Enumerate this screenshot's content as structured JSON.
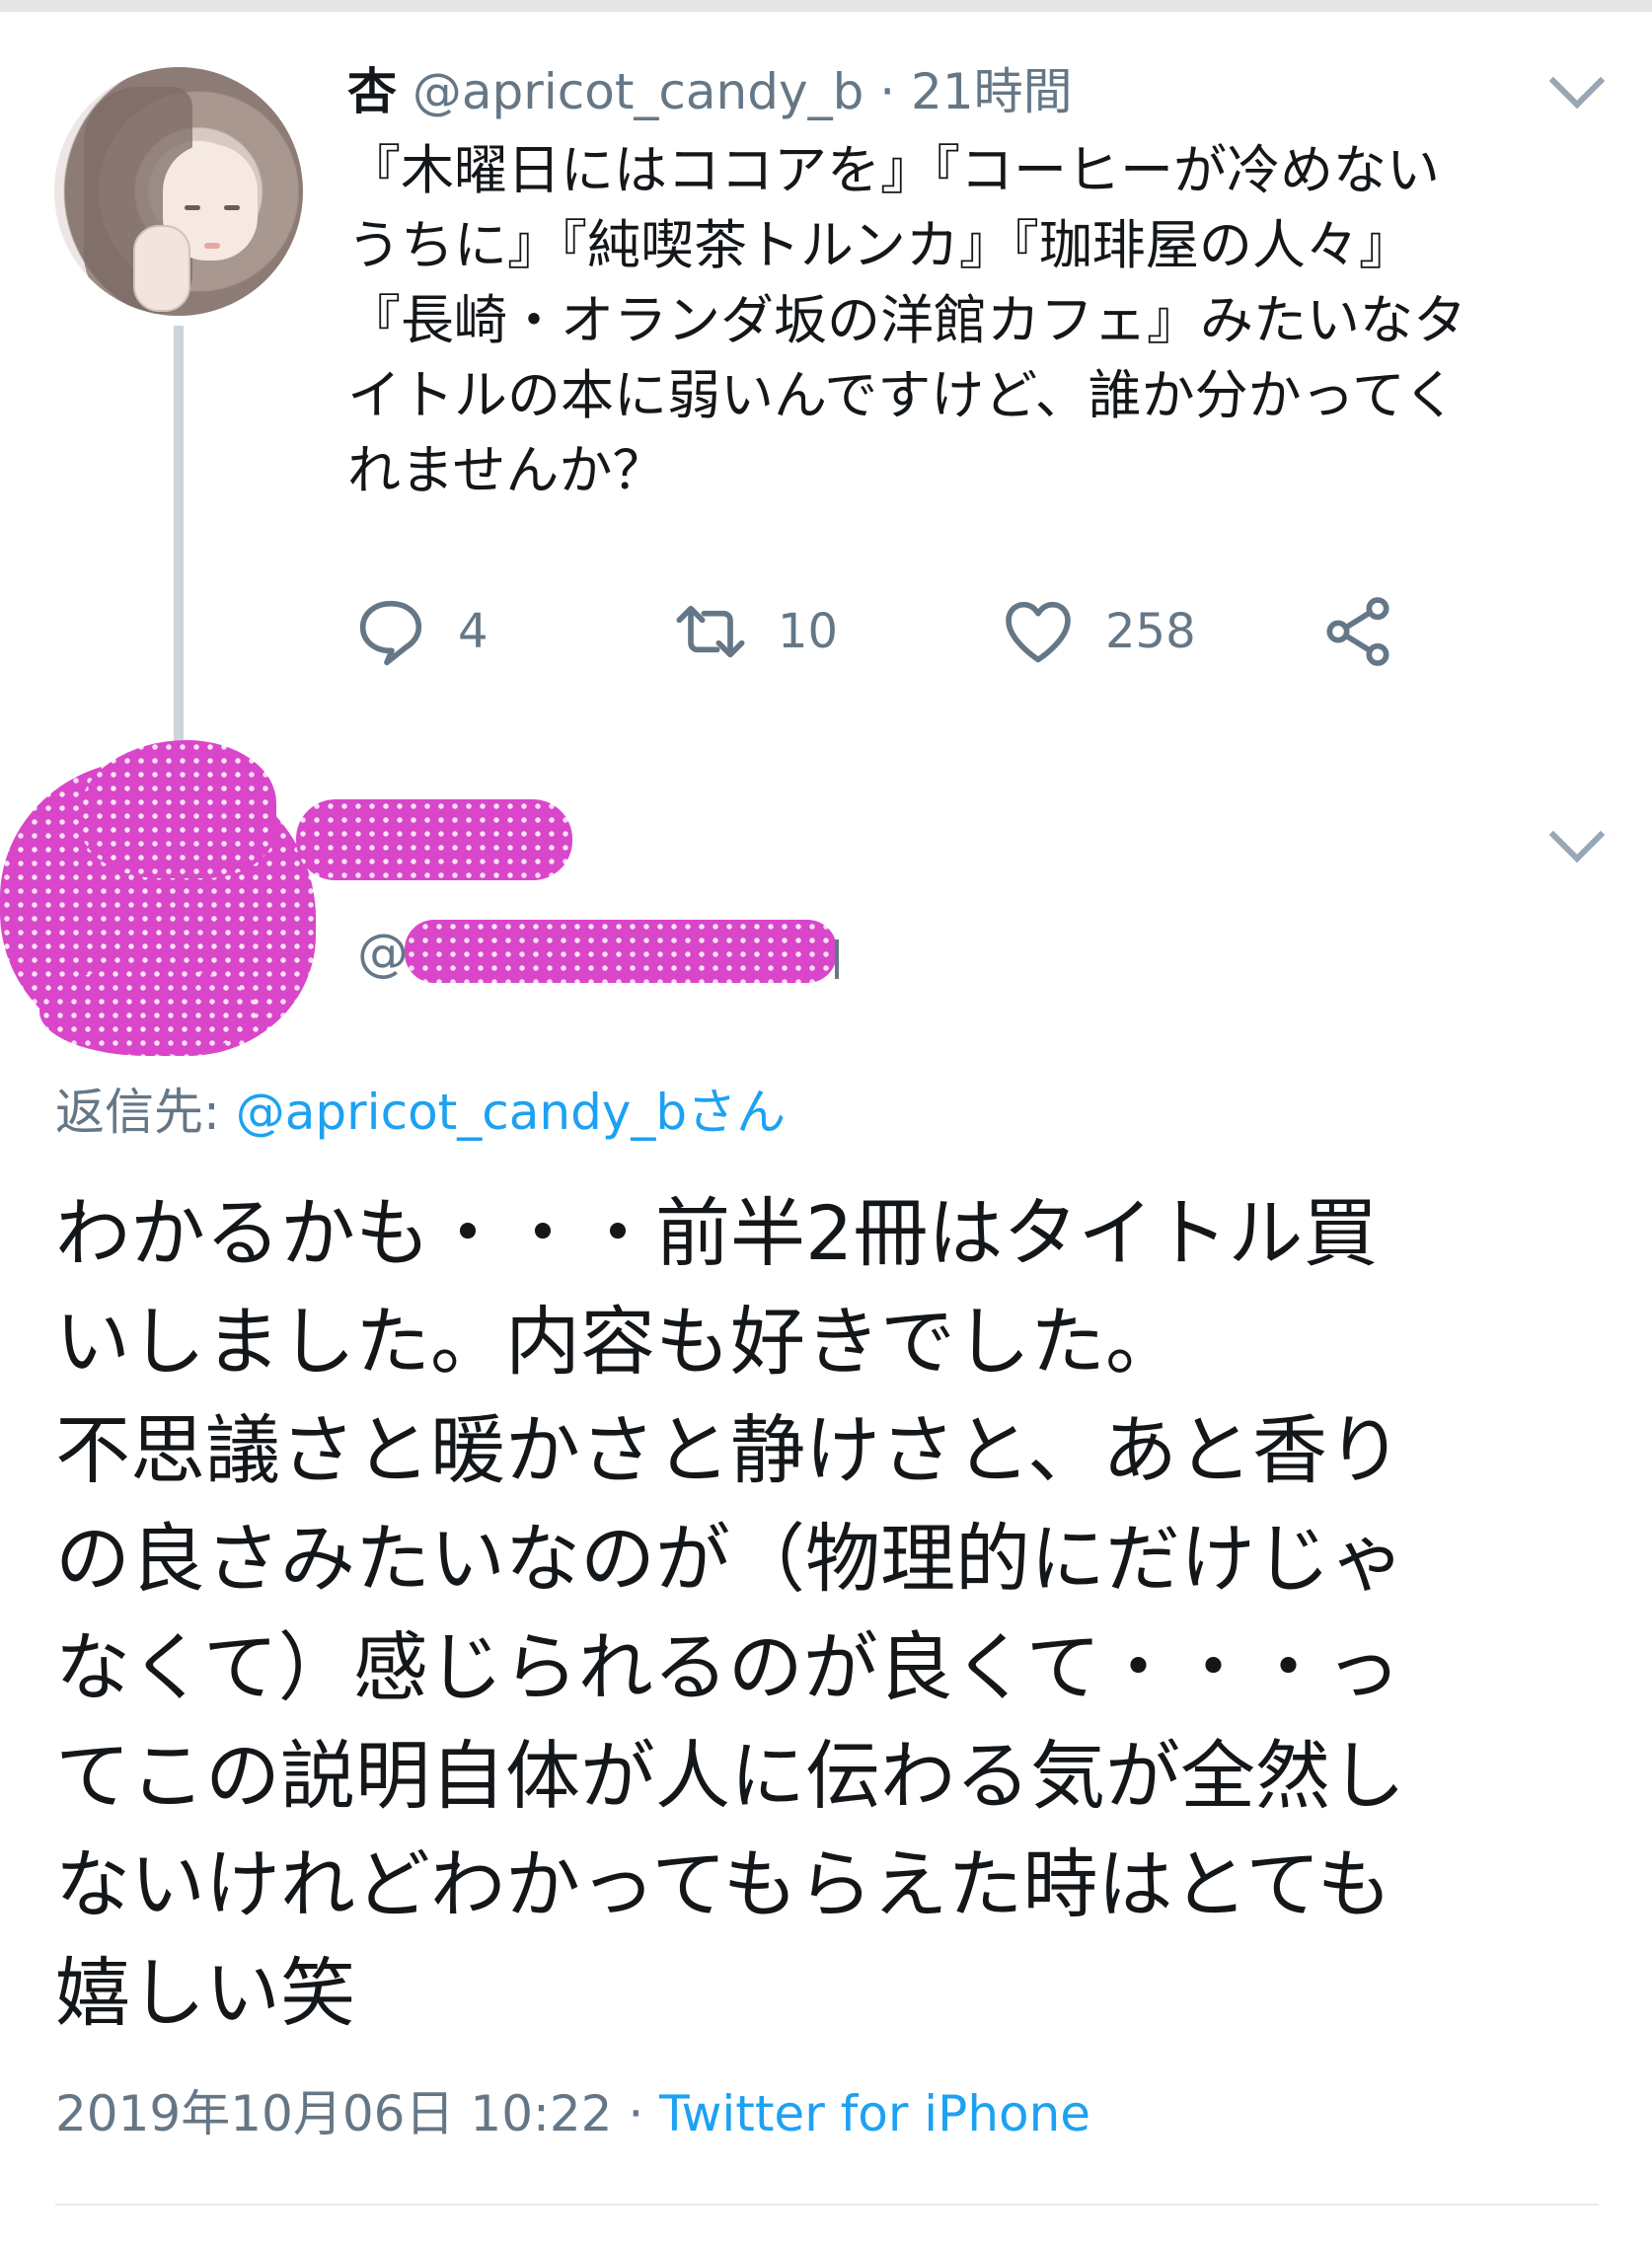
{
  "original_tweet": {
    "display_name": "杏",
    "handle": "@apricot_candy_b",
    "separator": "·",
    "time": "21時間",
    "text": "『木曜日にはココアを』『コーヒーが冷めない\nうちに』『純喫茶トルンカ』『珈琲屋の人々』\n『長崎・オランダ坂の洋館カフェ』みたいなタ\nイトルの本に弱いんですけど、誰か分かってく\nれませんか？",
    "stats": {
      "replies": "4",
      "retweets": "10",
      "likes": "258"
    },
    "icons": [
      "reply-icon",
      "retweet-icon",
      "like-icon",
      "share-icon",
      "chevron-down-icon",
      "avatar"
    ]
  },
  "reply_tweet": {
    "handle_prefix": "@",
    "replying_to_label": "返信先: ",
    "replying_to_handle": "@apricot_candy_bさん",
    "text": "わかるかも・・・前半2冊はタイトル買\nいしました。内容も好きでした。\n不思議さと暖かさと静けさと、あと香り\nの良さみたいなのが（物理的にだけじゃ\nなくて）感じられるのが良くて・・・っ\nてこの説明自体が人に伝わる気が全然し\nないけれどわかってもらえた時はとても\n嬉しい笑",
    "timestamp": "2019年10月06日 10:22",
    "separator": " · ",
    "source": "Twitter for iPhone"
  },
  "colors": {
    "text": "#14171a",
    "secondary": "#657786",
    "link": "#1da1f2",
    "thread_line": "#cdd5dc",
    "redaction": "#d946c9"
  }
}
